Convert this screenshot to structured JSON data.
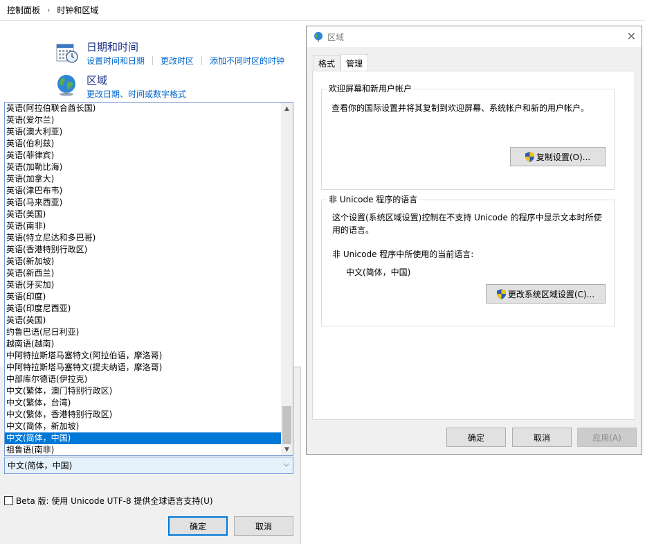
{
  "breadcrumb": {
    "items": [
      "控制面板",
      "时钟和区域"
    ],
    "separator": "›"
  },
  "datetime_section": {
    "title": "日期和时间",
    "links": [
      "设置时间和日期",
      "更改时区",
      "添加不同时区的时钟"
    ]
  },
  "region_section": {
    "title": "区域",
    "links": [
      "更改日期、时间或数字格式"
    ]
  },
  "language_list": {
    "items": [
      "英语(阿拉伯联合酋长国)",
      "英语(爱尔兰)",
      "英语(澳大利亚)",
      "英语(伯利兹)",
      "英语(菲律宾)",
      "英语(加勒比海)",
      "英语(加拿大)",
      "英语(津巴布韦)",
      "英语(马来西亚)",
      "英语(美国)",
      "英语(南非)",
      "英语(特立尼达和多巴哥)",
      "英语(香港特别行政区)",
      "英语(新加坡)",
      "英语(新西兰)",
      "英语(牙买加)",
      "英语(印度)",
      "英语(印度尼西亚)",
      "英语(英国)",
      "约鲁巴语(尼日利亚)",
      "越南语(越南)",
      "中阿特拉斯塔马塞特文(阿拉伯语，摩洛哥)",
      "中阿特拉斯塔马塞特文(提夫纳语，摩洛哥)",
      "中部库尔德语(伊拉克)",
      "中文(繁体，澳门特别行政区)",
      "中文(繁体，台湾)",
      "中文(繁体，香港特别行政区)",
      "中文(简体，新加坡)",
      "中文(简体，中国)",
      "祖鲁语(南非)"
    ],
    "selected": "中文(简体，中国)",
    "scroll_fraction": 0.95
  },
  "combo": {
    "value": "中文(简体，中国)"
  },
  "beta_checkbox": {
    "label": "Beta 版: 使用 Unicode UTF-8 提供全球语言支持(U)",
    "checked": false
  },
  "lower_buttons": {
    "ok": "确定",
    "cancel": "取消"
  },
  "dialog": {
    "title": "区域",
    "close": "✕",
    "tabs": [
      "格式",
      "管理"
    ],
    "active_tab": "管理",
    "welcome_group": {
      "legend": "欢迎屏幕和新用户帐户",
      "text": "查看你的国际设置并将其复制到欢迎屏幕、系统帐户和新的用户帐户。",
      "button": "复制设置(O)..."
    },
    "unicode_group": {
      "legend": "非 Unicode 程序的语言",
      "text": "这个设置(系统区域设置)控制在不支持 Unicode 的程序中显示文本时所使用的语言。",
      "current_label": "非 Unicode 程序中所使用的当前语言:",
      "current_value": "中文(简体，中国)",
      "button": "更改系统区域设置(C)..."
    },
    "buttons": {
      "ok": "确定",
      "cancel": "取消",
      "apply": "应用(A)"
    }
  },
  "colors": {
    "link": "#0066cc",
    "section_title": "#1e3287",
    "selection": "#0078d7"
  }
}
